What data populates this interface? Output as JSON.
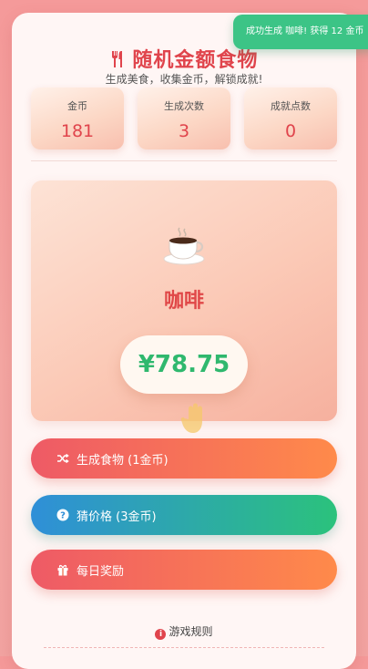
{
  "header": {
    "title": "随机金额食物",
    "subtitle": "生成美食，收集金币，解锁成就!"
  },
  "stats": [
    {
      "label": "金币",
      "value": "181"
    },
    {
      "label": "生成次数",
      "value": "3"
    },
    {
      "label": "成就点数",
      "value": "0"
    }
  ],
  "food": {
    "icon": "coffee-cup-icon",
    "name": "咖啡",
    "price": "¥78.75"
  },
  "buttons": {
    "generate": "生成食物 (1金币)",
    "guess": "猜价格 (3金币)",
    "daily": "每日奖励"
  },
  "footer": {
    "rules_link": "游戏规则"
  },
  "toast": {
    "message": "成功生成 咖啡! 获得 12 金币"
  },
  "colors": {
    "accent": "#e0444c",
    "price": "#2fb86e",
    "toast": "#3cc486"
  }
}
